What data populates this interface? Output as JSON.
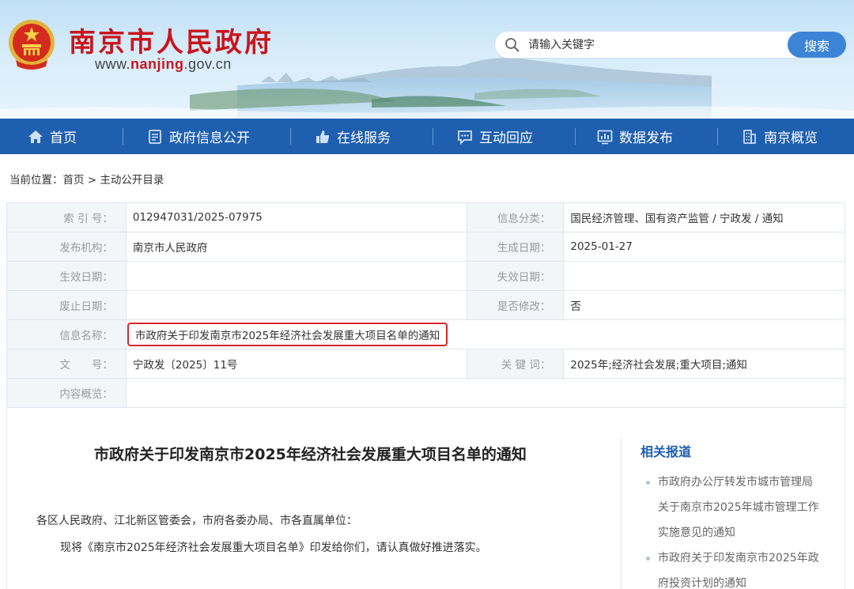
{
  "header": {
    "site_title": "南京市人民政府",
    "url_prefix": "www.",
    "url_domain": "nanjing",
    "url_suffix": ".gov.cn",
    "search_placeholder": "请输入关键字",
    "search_button": "搜索"
  },
  "nav": {
    "items": [
      {
        "label": "首页",
        "icon": "home-icon"
      },
      {
        "label": "政府信息公开",
        "icon": "document-icon"
      },
      {
        "label": "在线服务",
        "icon": "thumbs-up-icon"
      },
      {
        "label": "互动回应",
        "icon": "chat-icon"
      },
      {
        "label": "数据发布",
        "icon": "chart-icon"
      },
      {
        "label": "南京概览",
        "icon": "building-icon"
      }
    ]
  },
  "breadcrumb": {
    "prefix": "当前位置：",
    "home": "首页",
    "separator": " > ",
    "current": "主动公开目录"
  },
  "info": {
    "index_label": "索 引 号：",
    "index_value": "012947031/2025-07975",
    "category_label": "信息分类：",
    "category_value": "国民经济管理、国有资产监管 / 宁政发 / 通知",
    "publisher_label": "发布机构：",
    "publisher_value": "南京市人民政府",
    "created_label": "生成日期：",
    "created_value": "2025-01-27",
    "effective_label": "生效日期：",
    "effective_value": "",
    "expire_label": "失效日期：",
    "expire_value": "",
    "abolish_label": "废止日期：",
    "abolish_value": "",
    "modified_label": "是否修改：",
    "modified_value": "否",
    "name_label": "信息名称：",
    "name_value": "市政府关于印发南京市2025年经济社会发展重大项目名单的通知",
    "docno_label": "文　　号：",
    "docno_value": "宁政发〔2025〕11号",
    "keywords_label": "关 键 词：",
    "keywords_value": "2025年;经济社会发展;重大项目;通知",
    "summary_label": "内容概览：",
    "summary_value": ""
  },
  "article": {
    "title": "市政府关于印发南京市2025年经济社会发展重大项目名单的通知",
    "salutation": "各区人民政府、江北新区管委会，市府各委办局、市各直属单位：",
    "body": "现将《南京市2025年经济社会发展重大项目名单》印发给你们，请认真做好推进落实。"
  },
  "related": {
    "title": "相关报道",
    "items": [
      {
        "line1": "市政府办公厅转发市城市管理局",
        "line2": "关于南京市2025年城市管理工作",
        "line3": "实施意见的通知"
      },
      {
        "line1": "市政府关于印发南京市2025年政",
        "line2": "府投资计划的通知"
      }
    ]
  },
  "colors": {
    "brand_red": "#c8161d",
    "nav_blue": "#1f5fb0",
    "search_blue": "#3d84d6",
    "highlight_red": "#d9262c"
  }
}
